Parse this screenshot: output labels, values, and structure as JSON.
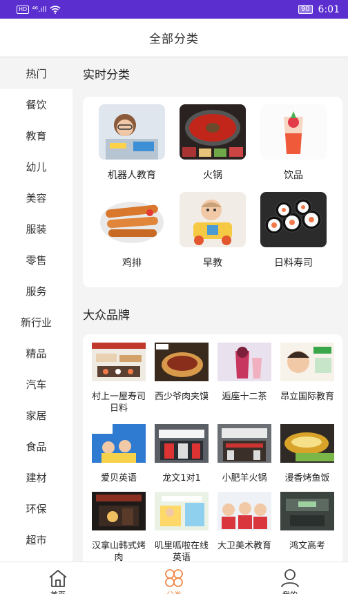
{
  "statusbar": {
    "hd": "HD",
    "signal": "⁴⁶.ıll",
    "battery": "90",
    "time": "6:01"
  },
  "header": {
    "title": "全部分类"
  },
  "sidebar": {
    "items": [
      {
        "label": "热门"
      },
      {
        "label": "餐饮"
      },
      {
        "label": "教育"
      },
      {
        "label": "幼儿"
      },
      {
        "label": "美容"
      },
      {
        "label": "服装"
      },
      {
        "label": "零售"
      },
      {
        "label": "服务"
      },
      {
        "label": "新行业"
      },
      {
        "label": "精品"
      },
      {
        "label": "汽车"
      },
      {
        "label": "家居"
      },
      {
        "label": "食品"
      },
      {
        "label": "建材"
      },
      {
        "label": "环保"
      },
      {
        "label": "超市"
      }
    ]
  },
  "realtime": {
    "title": "实时分类",
    "items": [
      {
        "label": "机器人教育",
        "icon": "robot-education-photo"
      },
      {
        "label": "火锅",
        "icon": "hotpot-photo"
      },
      {
        "label": "饮品",
        "icon": "drink-photo"
      },
      {
        "label": "鸡排",
        "icon": "chicken-cutlet-photo"
      },
      {
        "label": "早教",
        "icon": "early-education-photo"
      },
      {
        "label": "日料寿司",
        "icon": "sushi-photo"
      }
    ]
  },
  "brands": {
    "title": "大众品牌",
    "items": [
      {
        "label": "村上一屋寿司日料"
      },
      {
        "label": "西少爷肉夹馍"
      },
      {
        "label": "逅座十二茶"
      },
      {
        "label": "昂立国际教育"
      },
      {
        "label": "爱贝英语"
      },
      {
        "label": "龙文1对1"
      },
      {
        "label": "小肥羊火锅"
      },
      {
        "label": "漫香烤鱼饭"
      },
      {
        "label": "汉拿山韩式烤肉"
      },
      {
        "label": "叽里呱啦在线英语"
      },
      {
        "label": "大卫美术教育"
      },
      {
        "label": "鸿文高考"
      }
    ]
  },
  "tabbar": {
    "items": [
      {
        "label": "首页",
        "icon": "home-icon"
      },
      {
        "label": "分类",
        "icon": "category-icon"
      },
      {
        "label": "我的",
        "icon": "profile-icon"
      }
    ],
    "active_color": "#f08a4b"
  },
  "colors": {
    "statusbar": "#5b2ecf",
    "accent": "#f08a4b",
    "background": "#f4f4f4"
  }
}
